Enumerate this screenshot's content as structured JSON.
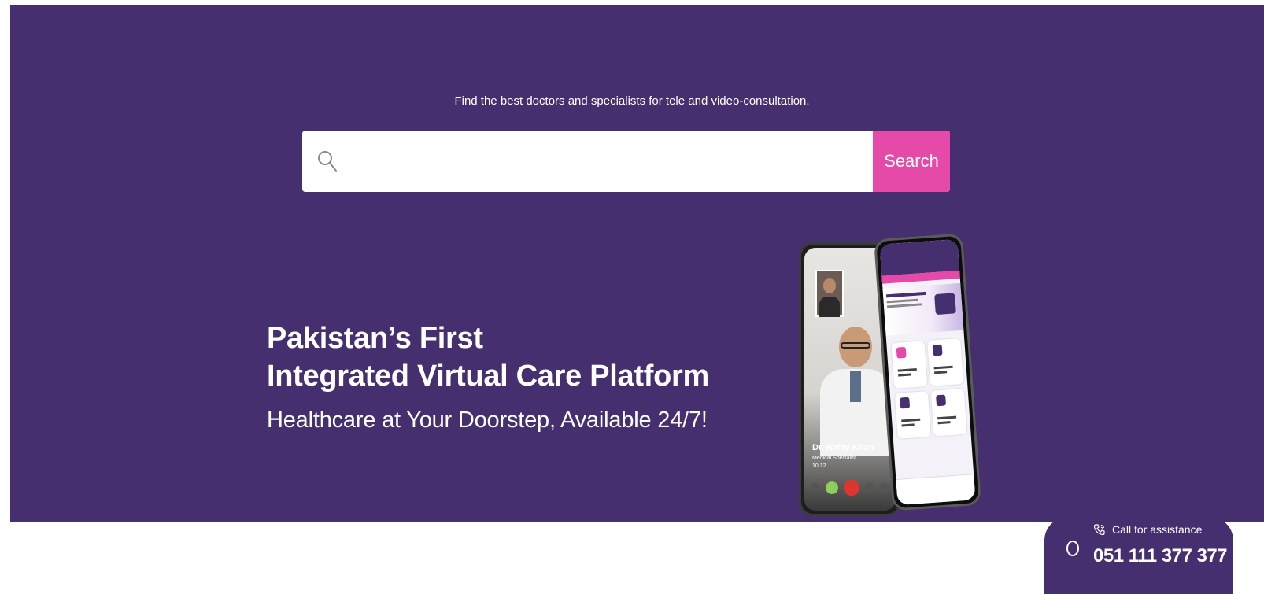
{
  "hero": {
    "tagline": "Find the best doctors and specialists for tele and video-consultation.",
    "search": {
      "placeholder": "",
      "value": "",
      "button_label": "Search",
      "icon": "search-icon"
    },
    "headline": {
      "line1": "Pakistan’s First",
      "line2": "Integrated Virtual Care Platform",
      "subtitle": "Healthcare at Your Doorstep, Available 24/7!"
    },
    "phone_mockup": {
      "doctor_name": "Dr. Rafay Khan",
      "doctor_role": "Medical Specialist",
      "call_time": "10:12"
    }
  },
  "assistance": {
    "label": "Call for assistance",
    "number": "051 111 377 377",
    "icon": "phone-icon"
  },
  "colors": {
    "hero_background": "#452f6e",
    "accent": "#e54aa8",
    "text_on_dark": "#ffffff"
  }
}
